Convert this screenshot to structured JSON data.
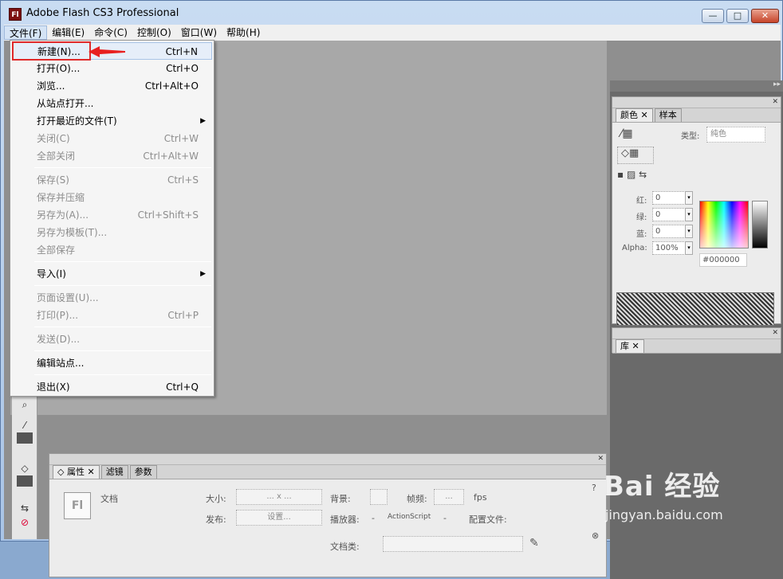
{
  "window": {
    "app_icon": "Fl",
    "title": "Adobe Flash CS3 Professional",
    "min": "—",
    "max": "□",
    "close": "✕"
  },
  "menubar": [
    "文件(F)",
    "编辑(E)",
    "命令(C)",
    "控制(O)",
    "窗口(W)",
    "帮助(H)"
  ],
  "file_menu": {
    "items": [
      {
        "label": "新建(N)...",
        "shortcut": "Ctrl+N",
        "disabled": false,
        "highlight": true
      },
      {
        "label": "打开(O)...",
        "shortcut": "Ctrl+O",
        "disabled": false
      },
      {
        "label": "浏览...",
        "shortcut": "Ctrl+Alt+O",
        "disabled": false
      },
      {
        "label": "从站点打开...",
        "shortcut": "",
        "disabled": false
      },
      {
        "label": "打开最近的文件(T)",
        "shortcut": "",
        "disabled": false,
        "submenu": true
      },
      {
        "label": "关闭(C)",
        "shortcut": "Ctrl+W",
        "disabled": true
      },
      {
        "label": "全部关闭",
        "shortcut": "Ctrl+Alt+W",
        "disabled": true
      },
      {
        "sep": true
      },
      {
        "label": "保存(S)",
        "shortcut": "Ctrl+S",
        "disabled": true
      },
      {
        "label": "保存并压缩",
        "shortcut": "",
        "disabled": true
      },
      {
        "label": "另存为(A)...",
        "shortcut": "Ctrl+Shift+S",
        "disabled": true
      },
      {
        "label": "另存为模板(T)...",
        "shortcut": "",
        "disabled": true
      },
      {
        "label": "全部保存",
        "shortcut": "",
        "disabled": true
      },
      {
        "sep": true
      },
      {
        "label": "导入(I)",
        "shortcut": "",
        "disabled": false,
        "submenu": true
      },
      {
        "sep": true
      },
      {
        "label": "页面设置(U)...",
        "shortcut": "",
        "disabled": true
      },
      {
        "label": "打印(P)...",
        "shortcut": "Ctrl+P",
        "disabled": true
      },
      {
        "sep": true
      },
      {
        "label": "发送(D)...",
        "shortcut": "",
        "disabled": true
      },
      {
        "sep": true
      },
      {
        "label": "编辑站点...",
        "shortcut": "",
        "disabled": false
      },
      {
        "sep": true
      },
      {
        "label": "退出(X)",
        "shortcut": "Ctrl+Q",
        "disabled": false
      }
    ]
  },
  "color_panel": {
    "tabs": [
      "颜色",
      "样本"
    ],
    "type_label": "类型:",
    "type_value": "纯色",
    "red_label": "红:",
    "green_label": "绿:",
    "blue_label": "蓝:",
    "alpha_label": "Alpha:",
    "red": "0",
    "green": "0",
    "blue": "0",
    "alpha": "100%",
    "hex": "#000000"
  },
  "library_panel": {
    "tabs": [
      "库"
    ]
  },
  "properties_panel": {
    "tabs": [
      "属性",
      "滤镜",
      "参数"
    ],
    "doc_label": "文档",
    "size_label": "大小:",
    "size_value": "... x ...",
    "bg_label": "背景:",
    "fps_label": "帧频:",
    "fps_value": "...",
    "fps_unit": "fps",
    "publish_label": "发布:",
    "settings_button": "设置...",
    "player_label": "播放器:",
    "player_value": "-",
    "as_value": "ActionScript",
    "as_dash": "-",
    "profile_label": "配置文件:",
    "doc_class_label": "文档类:"
  },
  "watermark": {
    "logo": "Bai 经验",
    "url": "jingyan.baidu.com"
  }
}
